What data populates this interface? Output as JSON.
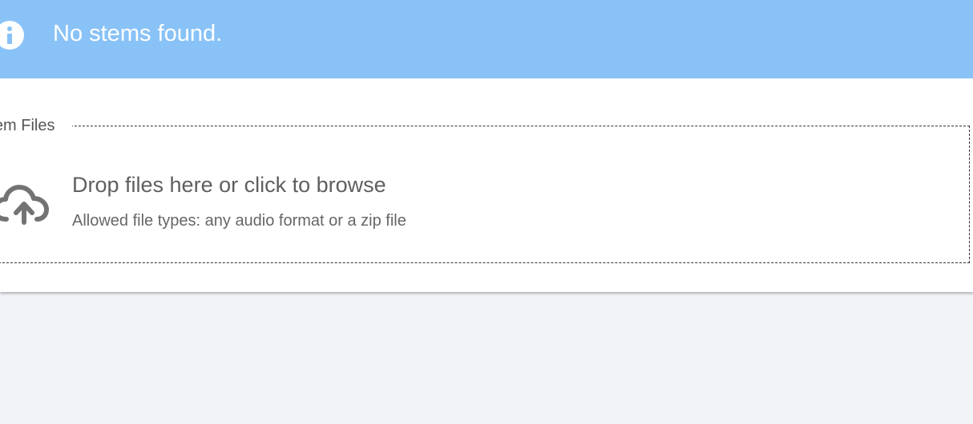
{
  "alert": {
    "icon": "info-icon",
    "message": "No stems found.",
    "background_color": "#89c2f7",
    "text_color": "#ffffff"
  },
  "upload": {
    "legend": "Stem Files",
    "icon": "cloud-upload-icon",
    "title": "Drop files here or click to browse",
    "hint": "Allowed file types: any audio format or a zip file",
    "text_color": "#5f5f5f"
  },
  "page": {
    "background_color": "#f1f3f6"
  }
}
